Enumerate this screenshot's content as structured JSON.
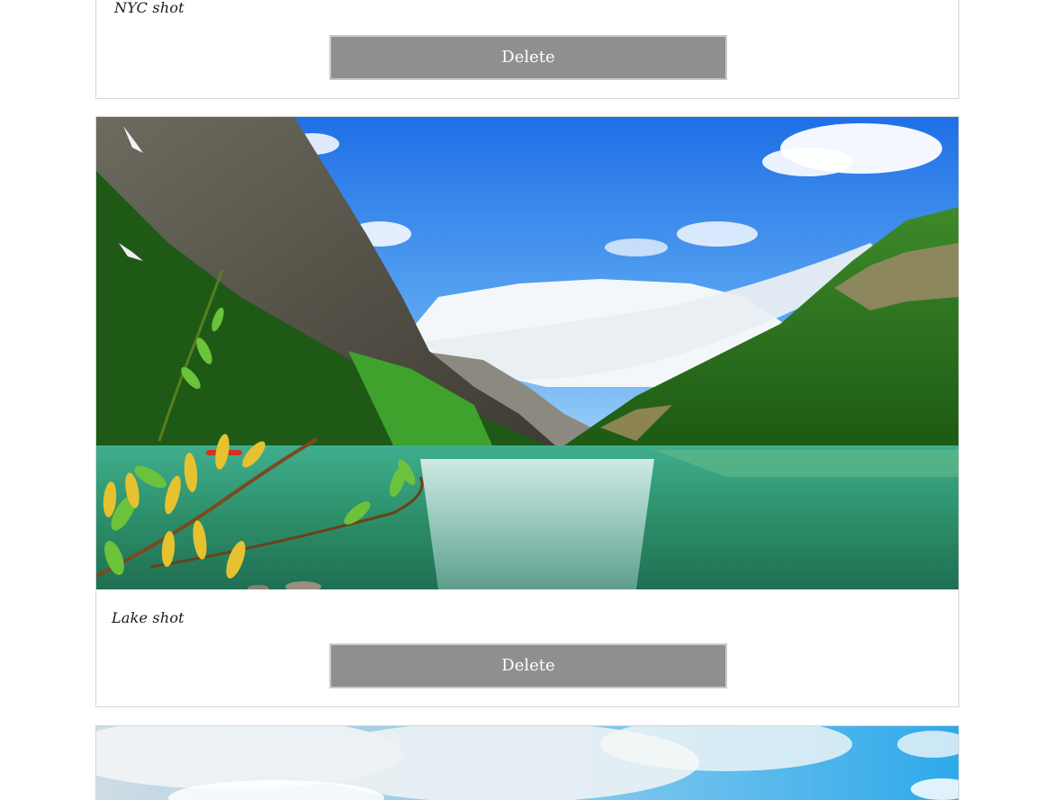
{
  "posts": [
    {
      "caption": "NYC shot",
      "delete_label": "Delete"
    },
    {
      "caption": "Lake shot",
      "delete_label": "Delete",
      "image_alt": "Mountain lake with forested slopes, snowy peaks and branch with yellow catkins"
    },
    {
      "caption": "",
      "image_alt": "Bright sky with white clouds"
    }
  ],
  "colors": {
    "button_bg": "#918e91",
    "button_border": "#c9c7c9",
    "card_border": "#d6d6d6",
    "sky": "#2e7fe8",
    "lake": "#2f9a6e",
    "forest": "#1f6b1d"
  }
}
